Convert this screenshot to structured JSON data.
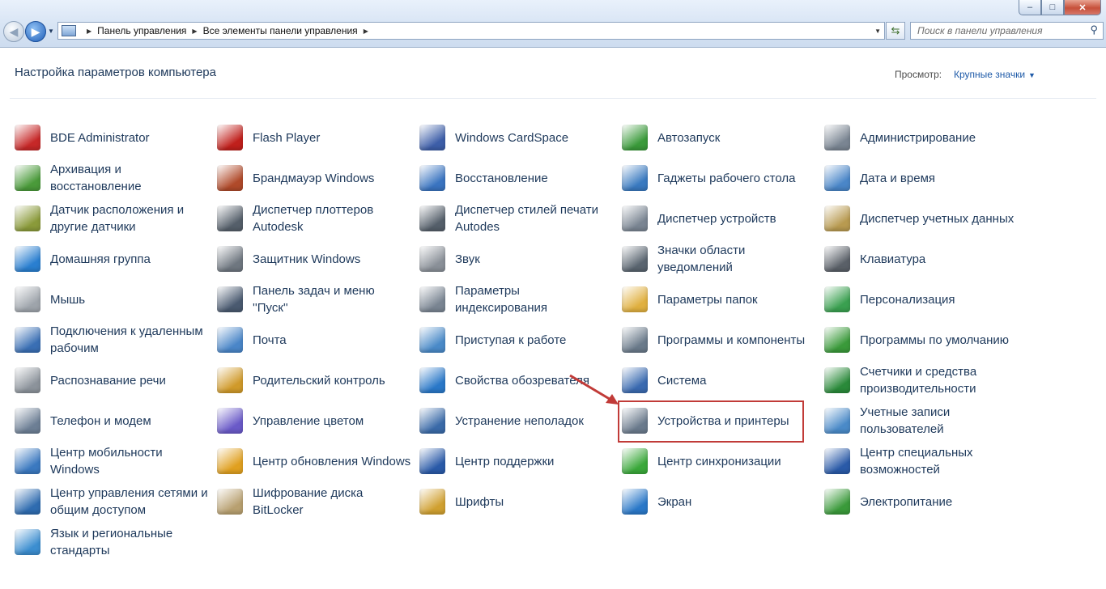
{
  "window": {
    "controls": {
      "minimize": "–",
      "maximize": "□",
      "close": "✕"
    }
  },
  "address_bar": {
    "breadcrumb": [
      "Панель управления",
      "Все элементы панели управления"
    ]
  },
  "search": {
    "placeholder": "Поиск в панели управления"
  },
  "header": {
    "title": "Настройка параметров компьютера",
    "view_label": "Просмотр:",
    "view_value": "Крупные значки"
  },
  "columns": [
    [
      {
        "label": "BDE Administrator",
        "icon": "bde-icon",
        "color": "#c62828"
      },
      {
        "label": "Архивация и восстановление",
        "icon": "backup-icon",
        "color": "#4a9a3a"
      },
      {
        "label": "Датчик расположения и другие датчики",
        "icon": "sensor-icon",
        "color": "#8a9a3a"
      },
      {
        "label": "Домашняя группа",
        "icon": "homegroup-icon",
        "color": "#2a7fd0"
      },
      {
        "label": "Мышь",
        "icon": "mouse-icon",
        "color": "#9ea4ab"
      },
      {
        "label": "Подключения к удаленным рабочим",
        "icon": "remote-icon",
        "color": "#3a6fb4"
      },
      {
        "label": "Распознавание речи",
        "icon": "microphone-icon",
        "color": "#8c939b"
      },
      {
        "label": "Телефон и модем",
        "icon": "phone-icon",
        "color": "#6d7f95"
      },
      {
        "label": "Центр мобильности Windows",
        "icon": "mobility-icon",
        "color": "#3b79c0"
      },
      {
        "label": "Центр управления сетями и общим доступом",
        "icon": "network-icon",
        "color": "#2f6cb0"
      },
      {
        "label": "Язык и региональные стандарты",
        "icon": "globe-icon",
        "color": "#3c8ed0"
      }
    ],
    [
      {
        "label": "Flash Player",
        "icon": "flash-icon",
        "color": "#c0201c"
      },
      {
        "label": "Брандмауэр Windows",
        "icon": "firewall-icon",
        "color": "#b04a2a"
      },
      {
        "label": "Диспетчер плоттеров Autodesk",
        "icon": "plotter-icon",
        "color": "#555f6a"
      },
      {
        "label": "Защитник Windows",
        "icon": "defender-icon",
        "color": "#6f7780"
      },
      {
        "label": "Панель задач и меню ''Пуск''",
        "icon": "taskbar-icon",
        "color": "#4a5a70"
      },
      {
        "label": "Почта",
        "icon": "mail-icon",
        "color": "#4a86c8"
      },
      {
        "label": "Родительский контроль",
        "icon": "parental-icon",
        "color": "#d09a2a"
      },
      {
        "label": "Управление цветом",
        "icon": "color-icon",
        "color": "#6a5ac8"
      },
      {
        "label": "Центр обновления Windows",
        "icon": "update-icon",
        "color": "#e0a020"
      },
      {
        "label": "Шифрование диска BitLocker",
        "icon": "bitlocker-icon",
        "color": "#b8a070"
      }
    ],
    [
      {
        "label": "Windows CardSpace",
        "icon": "cardspace-icon",
        "color": "#3d5ea8"
      },
      {
        "label": "Восстановление",
        "icon": "recovery-icon",
        "color": "#3a74c0"
      },
      {
        "label": "Диспетчер стилей печати Autodes",
        "icon": "print-styles-icon",
        "color": "#555f6a"
      },
      {
        "label": "Звук",
        "icon": "speaker-icon",
        "color": "#8a9098"
      },
      {
        "label": "Параметры индексирования",
        "icon": "indexing-icon",
        "color": "#7a8592"
      },
      {
        "label": "Приступая к работе",
        "icon": "getting-started-icon",
        "color": "#4a8ac8"
      },
      {
        "label": "Свойства обозревателя",
        "icon": "internet-options-icon",
        "color": "#2a78c8"
      },
      {
        "label": "Устранение неполадок",
        "icon": "troubleshoot-icon",
        "color": "#3a6aa8"
      },
      {
        "label": "Центр поддержки",
        "icon": "flag-icon",
        "color": "#2a5aa8"
      },
      {
        "label": "Шрифты",
        "icon": "fonts-icon",
        "color": "#d0a030"
      }
    ],
    [
      {
        "label": "Автозапуск",
        "icon": "autoplay-icon",
        "color": "#3a9a3a"
      },
      {
        "label": "Гаджеты рабочего стола",
        "icon": "gadgets-icon",
        "color": "#3a7ac0"
      },
      {
        "label": "Диспетчер устройств",
        "icon": "device-manager-icon",
        "color": "#7a8592"
      },
      {
        "label": "Значки области уведомлений",
        "icon": "notification-icon",
        "color": "#5a6570"
      },
      {
        "label": "Параметры папок",
        "icon": "folder-icon",
        "color": "#e0b040"
      },
      {
        "label": "Программы и компоненты",
        "icon": "programs-icon",
        "color": "#6a7a8a"
      },
      {
        "label": "Система",
        "icon": "system-icon",
        "color": "#3a6ab0"
      },
      {
        "label": "Устройства и принтеры",
        "icon": "printer-icon",
        "color": "#6a7a8c"
      },
      {
        "label": "Центр синхронизации",
        "icon": "sync-icon",
        "color": "#3aa83a"
      },
      {
        "label": "Экран",
        "icon": "display-icon",
        "color": "#2a78c8"
      }
    ],
    [
      {
        "label": "Администрирование",
        "icon": "admin-tools-icon",
        "color": "#7a8592"
      },
      {
        "label": "Дата и время",
        "icon": "clock-icon",
        "color": "#4a86c8"
      },
      {
        "label": "Диспетчер учетных данных",
        "icon": "credentials-icon",
        "color": "#b89a50"
      },
      {
        "label": "Клавиатура",
        "icon": "keyboard-icon",
        "color": "#5a6068"
      },
      {
        "label": "Персонализация",
        "icon": "personalization-icon",
        "color": "#3aa050"
      },
      {
        "label": "Программы по умолчанию",
        "icon": "default-programs-icon",
        "color": "#3a9a3a"
      },
      {
        "label": "Счетчики и средства производительности",
        "icon": "performance-icon",
        "color": "#2a8a3a"
      },
      {
        "label": "Учетные записи пользователей",
        "icon": "users-icon",
        "color": "#4a8ac8"
      },
      {
        "label": "Центр специальных возможностей",
        "icon": "accessibility-icon",
        "color": "#2a5aa8"
      },
      {
        "label": "Электропитание",
        "icon": "power-icon",
        "color": "#3a9a3a"
      }
    ]
  ]
}
